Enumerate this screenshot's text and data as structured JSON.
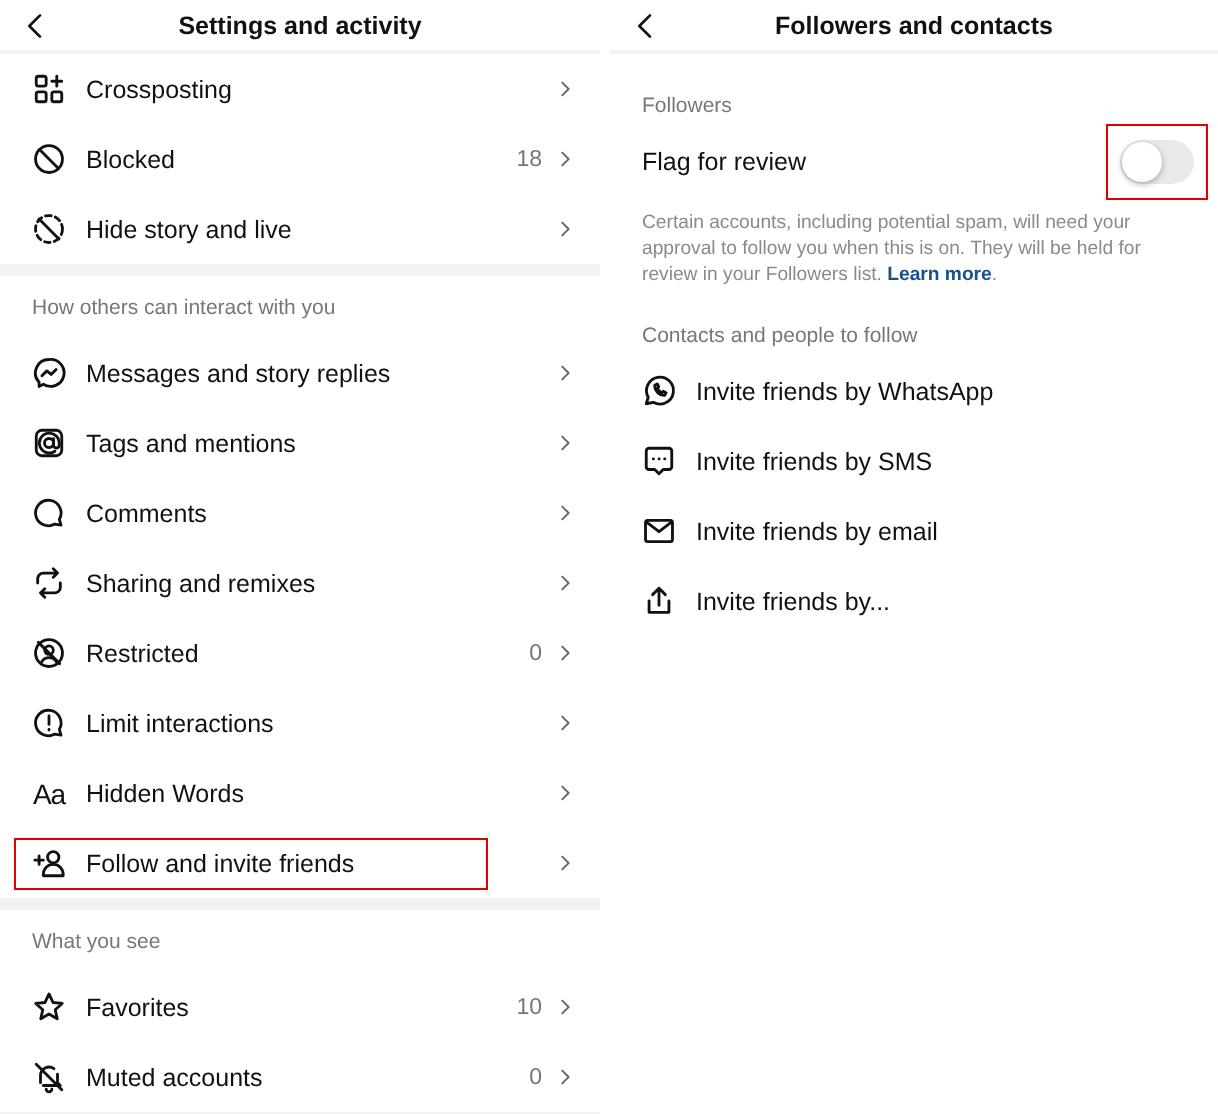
{
  "left": {
    "title": "Settings and activity",
    "sections": [
      {
        "items": [
          {
            "label": "Crossposting",
            "highlighted": false
          },
          {
            "label": "Blocked",
            "count": "18",
            "highlighted": false
          },
          {
            "label": "Hide story and live",
            "highlighted": false
          }
        ]
      },
      {
        "heading": "How others can interact with you",
        "items": [
          {
            "label": "Messages and story replies",
            "highlighted": false
          },
          {
            "label": "Tags and mentions",
            "highlighted": false
          },
          {
            "label": "Comments",
            "highlighted": false
          },
          {
            "label": "Sharing and remixes",
            "highlighted": false
          },
          {
            "label": "Restricted",
            "count": "0",
            "highlighted": false
          },
          {
            "label": "Limit interactions",
            "highlighted": false
          },
          {
            "label": "Hidden Words",
            "glyph": "Aa",
            "highlighted": false
          },
          {
            "label": "Follow and invite friends",
            "highlighted": true
          }
        ]
      },
      {
        "heading": "What you see",
        "items": [
          {
            "label": "Favorites",
            "count": "10",
            "highlighted": false
          },
          {
            "label": "Muted accounts",
            "count": "0",
            "highlighted": false
          }
        ]
      }
    ]
  },
  "right": {
    "title": "Followers and contacts",
    "followers": {
      "heading": "Followers",
      "toggle": {
        "label": "Flag for review",
        "on": false,
        "highlighted": true
      },
      "description": {
        "text": "Certain accounts, including potential spam, will need your approval to follow you when this is on. They will be held for review in your Followers list.",
        "link": "Learn more",
        "end": "."
      }
    },
    "contacts": {
      "heading": "Contacts and people to follow",
      "items": [
        {
          "label": "Invite friends by WhatsApp"
        },
        {
          "label": "Invite friends by SMS"
        },
        {
          "label": "Invite friends by email"
        },
        {
          "label": "Invite friends by..."
        }
      ]
    }
  }
}
